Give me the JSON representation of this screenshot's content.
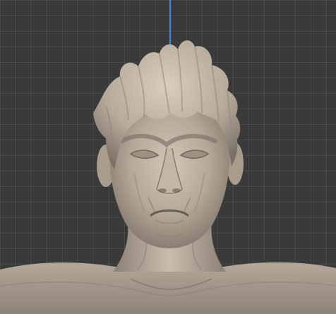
{
  "viewport": {
    "mode": "sculpt",
    "background_color": "#3a3a3a",
    "grid_color": "#4a4a4a",
    "axis_color": "#3d8ee8",
    "model_color": "#b8ad9f"
  }
}
